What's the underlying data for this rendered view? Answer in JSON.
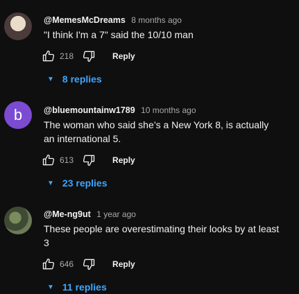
{
  "comments": [
    {
      "avatar_letter": "",
      "handle": "@MemesMcDreams",
      "time": "8 months ago",
      "text": "\"I think I'm a 7\" said the 10/10 man",
      "likes": "218",
      "reply_label": "Reply",
      "replies_label": "8 replies"
    },
    {
      "avatar_letter": "b",
      "handle": "@bluemountainw1789",
      "time": "10 months ago",
      "text": "The woman who said she’s a New York 8, is actually an international 5.",
      "likes": "613",
      "reply_label": "Reply",
      "replies_label": "23 replies"
    },
    {
      "avatar_letter": "",
      "handle": "@Me-ng9ut",
      "time": "1 year ago",
      "text": "These people are overestimating their looks by at least 3",
      "likes": "646",
      "reply_label": "Reply",
      "replies_label": "11 replies"
    }
  ],
  "icons": {
    "like": "thumbs-up-icon",
    "dislike": "thumbs-down-icon",
    "expand": "chevron-down-icon"
  },
  "colors": {
    "background": "#0f0f0f",
    "link": "#3ea6ff",
    "avatar_b": "#7b4bd2"
  }
}
